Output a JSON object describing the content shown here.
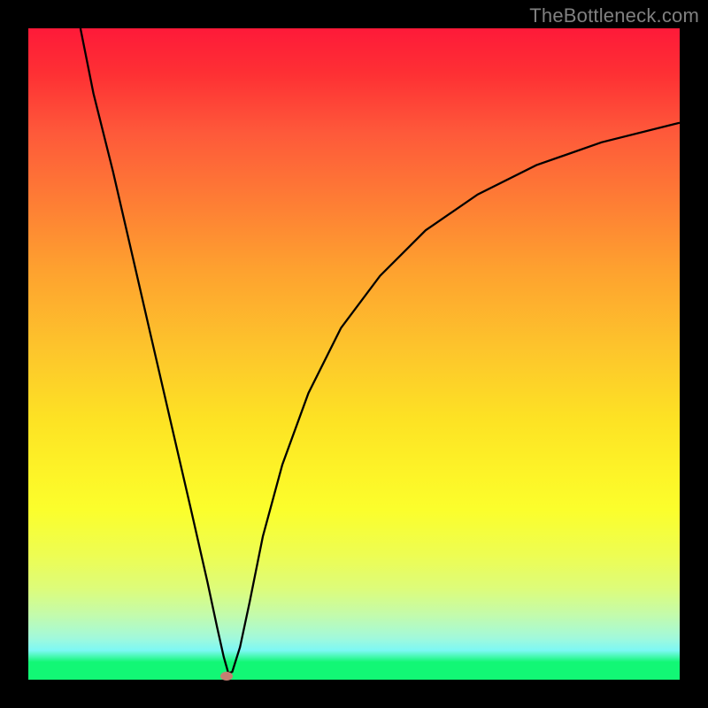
{
  "watermark": "TheBottleneck.com",
  "chart_data": {
    "type": "line",
    "title": "",
    "xlabel": "",
    "ylabel": "",
    "xlim": [
      0,
      100
    ],
    "ylim": [
      0,
      100
    ],
    "background_gradient": "red-yellow-green (bottleneck severity scale)",
    "series": [
      {
        "name": "bottleneck-curve",
        "x": [
          8,
          10,
          13,
          16,
          19,
          22,
          25,
          27.5,
          29,
          30,
          30.7,
          31.3,
          32.5,
          34,
          36,
          39,
          43,
          48,
          54,
          61,
          69,
          78,
          88,
          100
        ],
        "y": [
          100,
          90,
          78,
          65,
          52,
          39,
          26,
          15,
          8,
          3.5,
          1,
          1.2,
          5,
          12,
          22,
          33,
          44,
          54,
          62,
          69,
          74.5,
          79,
          82.5,
          85.5
        ]
      }
    ],
    "marker": {
      "name": "optimal-point",
      "x": 30.5,
      "y": 0.5,
      "color": "#c67f72"
    }
  },
  "plot": {
    "marker_left_pct": 30.5,
    "marker_top_pct": 99.5
  }
}
